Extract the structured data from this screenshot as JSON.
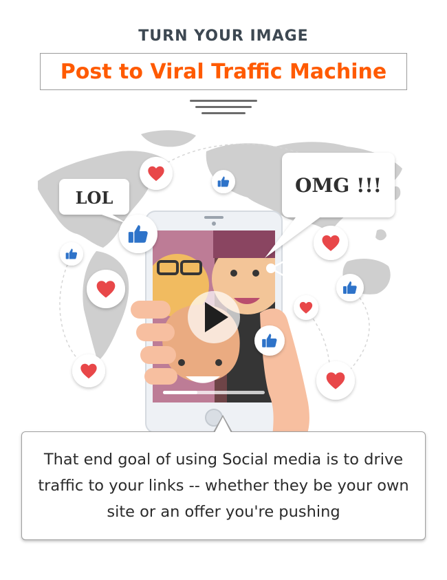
{
  "header": {
    "eyebrow": "TURN YOUR IMAGE",
    "title": "Post to Viral Traffic Machine"
  },
  "illustration": {
    "bubble_left": "LOL",
    "bubble_right": "OMG !!!"
  },
  "caption": {
    "text": "That end goal of using Social media is to drive traffic to your links -- whether they be your own site or an offer you're pushing"
  },
  "colors": {
    "accent": "#ff5a00",
    "heading": "#3d4852",
    "heart": "#e8464a",
    "like": "#2f73c9",
    "map": "#cfcfcf"
  }
}
